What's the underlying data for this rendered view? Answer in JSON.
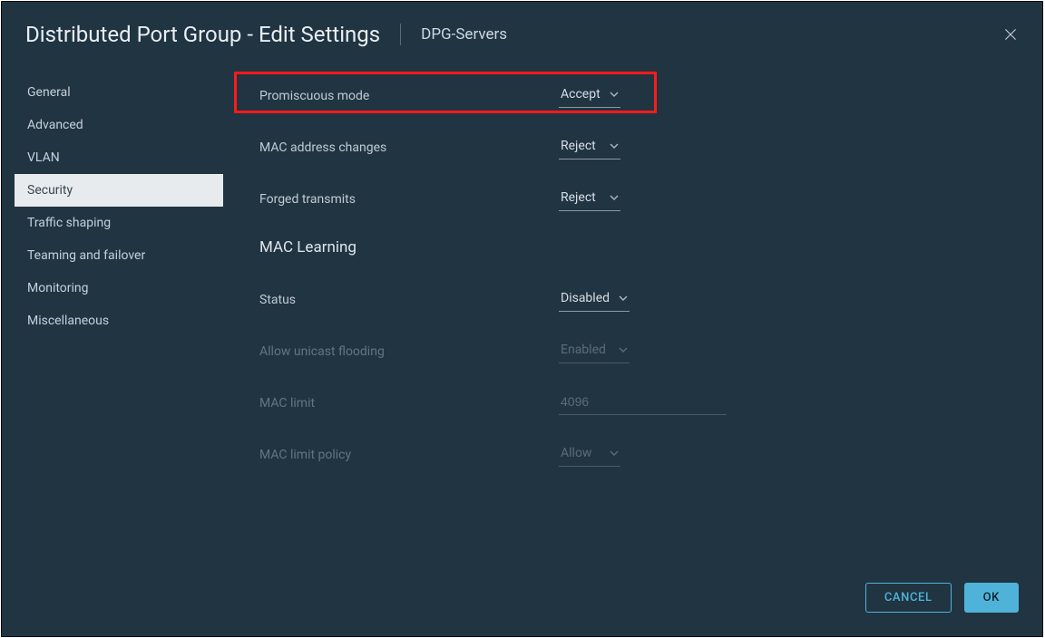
{
  "header": {
    "title": "Distributed Port Group - Edit Settings",
    "subtitle": "DPG-Servers"
  },
  "sidebar": {
    "items": [
      {
        "label": "General"
      },
      {
        "label": "Advanced"
      },
      {
        "label": "VLAN"
      },
      {
        "label": "Security"
      },
      {
        "label": "Traffic shaping"
      },
      {
        "label": "Teaming and failover"
      },
      {
        "label": "Monitoring"
      },
      {
        "label": "Miscellaneous"
      }
    ],
    "activeIndex": 3
  },
  "security": {
    "promiscuous_label": "Promiscuous mode",
    "promiscuous_value": "Accept",
    "mac_changes_label": "MAC address changes",
    "mac_changes_value": "Reject",
    "forged_label": "Forged transmits",
    "forged_value": "Reject"
  },
  "mac_learning": {
    "heading": "MAC Learning",
    "status_label": "Status",
    "status_value": "Disabled",
    "flooding_label": "Allow unicast flooding",
    "flooding_value": "Enabled",
    "limit_label": "MAC limit",
    "limit_value": "4096",
    "policy_label": "MAC limit policy",
    "policy_value": "Allow"
  },
  "footer": {
    "cancel": "CANCEL",
    "ok": "OK"
  }
}
